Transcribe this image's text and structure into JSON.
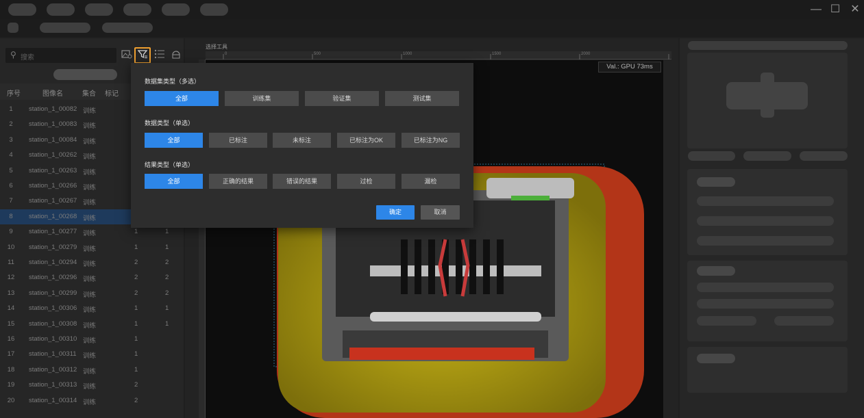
{
  "window_controls": {
    "minimize": "—",
    "maximize": "☐",
    "close": "✕"
  },
  "search": {
    "placeholder": "搜索",
    "icon": "search-icon"
  },
  "left_toolbar_icons": [
    "image-settings-icon",
    "filter-icon",
    "list-icon",
    "rotate-icon"
  ],
  "table": {
    "headers": [
      "序号",
      "图像名",
      "集合",
      "标记"
    ],
    "rows": [
      {
        "idx": "1",
        "name": "station_1_00082",
        "set": "训练",
        "mark": ""
      },
      {
        "idx": "2",
        "name": "station_1_00083",
        "set": "训练",
        "mark": ""
      },
      {
        "idx": "3",
        "name": "station_1_00084",
        "set": "训练",
        "mark": ""
      },
      {
        "idx": "4",
        "name": "station_1_00262",
        "set": "训练",
        "mark": ""
      },
      {
        "idx": "5",
        "name": "station_1_00263",
        "set": "训练",
        "mark": ""
      },
      {
        "idx": "6",
        "name": "station_1_00266",
        "set": "训练",
        "mark": ""
      },
      {
        "idx": "7",
        "name": "station_1_00267",
        "set": "训练",
        "mark": ""
      },
      {
        "idx": "8",
        "name": "station_1_00268",
        "set": "训练",
        "mark": ""
      },
      {
        "idx": "9",
        "name": "station_1_00277",
        "set": "训练",
        "mark": "1",
        "extra": "1"
      },
      {
        "idx": "10",
        "name": "station_1_00279",
        "set": "训练",
        "mark": "1",
        "extra": "1"
      },
      {
        "idx": "11",
        "name": "station_1_00294",
        "set": "训练",
        "mark": "2",
        "extra": "2"
      },
      {
        "idx": "12",
        "name": "station_1_00296",
        "set": "训练",
        "mark": "2",
        "extra": "2"
      },
      {
        "idx": "13",
        "name": "station_1_00299",
        "set": "训练",
        "mark": "2",
        "extra": "2"
      },
      {
        "idx": "14",
        "name": "station_1_00306",
        "set": "训练",
        "mark": "1",
        "extra": "1"
      },
      {
        "idx": "15",
        "name": "station_1_00308",
        "set": "训练",
        "mark": "1",
        "extra": "1"
      },
      {
        "idx": "16",
        "name": "station_1_00310",
        "set": "训练",
        "mark": "1",
        "extra": ""
      },
      {
        "idx": "17",
        "name": "station_1_00311",
        "set": "训练",
        "mark": "1",
        "extra": ""
      },
      {
        "idx": "18",
        "name": "station_1_00312",
        "set": "训练",
        "mark": "1",
        "extra": ""
      },
      {
        "idx": "19",
        "name": "station_1_00313",
        "set": "训练",
        "mark": "2",
        "extra": ""
      },
      {
        "idx": "20",
        "name": "station_1_00314",
        "set": "训练",
        "mark": "2",
        "extra": ""
      }
    ],
    "selected_index": 7
  },
  "canvas": {
    "tool_title": "选择工具",
    "ruler_ticks": [
      "0",
      "500",
      "1000",
      "1500",
      "2000",
      "2500"
    ],
    "gpu_label": "Val.: GPU 73ms"
  },
  "filter_popup": {
    "dataset_type_label": "数据集类型（多选）",
    "dataset_type_options": [
      "全部",
      "训练集",
      "验证集",
      "测试集"
    ],
    "data_type_label": "数据类型（单选）",
    "data_type_options": [
      "全部",
      "已标注",
      "未标注",
      "已标注为OK",
      "已标注为NG"
    ],
    "result_type_label": "结果类型（单选）",
    "result_type_options": [
      "全部",
      "正确的结果",
      "错误的结果",
      "过检",
      "漏检"
    ],
    "ok_label": "确定",
    "cancel_label": "取消"
  },
  "colors": {
    "accent": "#2d86e8",
    "highlight": "#f0a030",
    "selection": "#1e3a5c"
  }
}
